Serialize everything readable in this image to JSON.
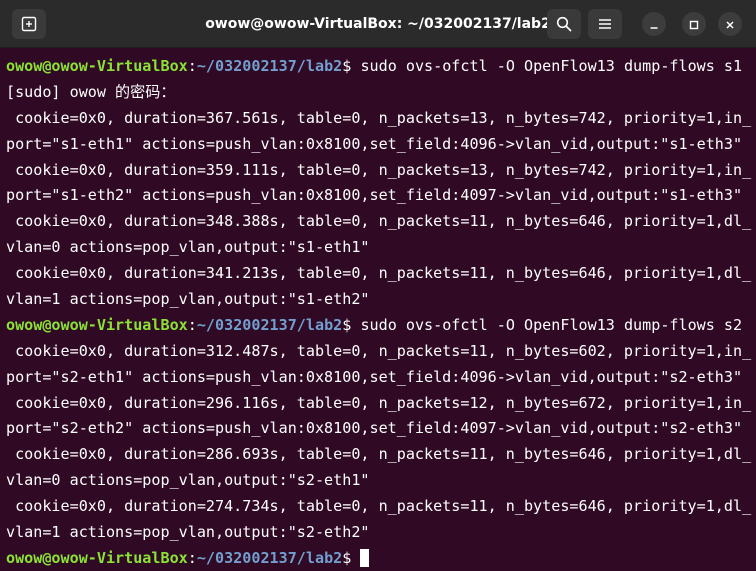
{
  "window": {
    "title": "owow@owow-VirtualBox: ~/032002137/lab2"
  },
  "icons": {
    "new_tab": "new-tab-icon",
    "search": "search-icon",
    "menu": "hamburger-menu-icon",
    "minimize": "minimize-icon",
    "maximize": "maximize-icon",
    "close": "close-icon"
  },
  "colors": {
    "terminal_bg": "#300a24",
    "prompt_user": "#8ae234",
    "prompt_path": "#729fcf",
    "text": "#ffffff"
  },
  "terminal": {
    "prompt": {
      "user_host": "owow@owow-VirtualBox",
      "colon": ":",
      "path": "~/032002137/lab2",
      "dollar": "$ "
    },
    "lines": [
      {
        "type": "cmd",
        "text": "sudo ovs-ofctl -O OpenFlow13 dump-flows s1"
      },
      {
        "type": "out",
        "text": "[sudo] owow 的密码："
      },
      {
        "type": "out",
        "text": " cookie=0x0, duration=367.561s, table=0, n_packets=13, n_bytes=742, priority=1,in_"
      },
      {
        "type": "out",
        "text": "port=\"s1-eth1\" actions=push_vlan:0x8100,set_field:4096->vlan_vid,output:\"s1-eth3\""
      },
      {
        "type": "out",
        "text": " cookie=0x0, duration=359.111s, table=0, n_packets=13, n_bytes=742, priority=1,in_"
      },
      {
        "type": "out",
        "text": "port=\"s1-eth2\" actions=push_vlan:0x8100,set_field:4097->vlan_vid,output:\"s1-eth3\""
      },
      {
        "type": "out",
        "text": " cookie=0x0, duration=348.388s, table=0, n_packets=11, n_bytes=646, priority=1,dl_"
      },
      {
        "type": "out",
        "text": "vlan=0 actions=pop_vlan,output:\"s1-eth1\""
      },
      {
        "type": "out",
        "text": " cookie=0x0, duration=341.213s, table=0, n_packets=11, n_bytes=646, priority=1,dl_"
      },
      {
        "type": "out",
        "text": "vlan=1 actions=pop_vlan,output:\"s1-eth2\""
      },
      {
        "type": "cmd",
        "text": "sudo ovs-ofctl -O OpenFlow13 dump-flows s2"
      },
      {
        "type": "out",
        "text": " cookie=0x0, duration=312.487s, table=0, n_packets=11, n_bytes=602, priority=1,in_"
      },
      {
        "type": "out",
        "text": "port=\"s2-eth1\" actions=push_vlan:0x8100,set_field:4096->vlan_vid,output:\"s2-eth3\""
      },
      {
        "type": "out",
        "text": " cookie=0x0, duration=296.116s, table=0, n_packets=12, n_bytes=672, priority=1,in_"
      },
      {
        "type": "out",
        "text": "port=\"s2-eth2\" actions=push_vlan:0x8100,set_field:4097->vlan_vid,output:\"s2-eth3\""
      },
      {
        "type": "out",
        "text": " cookie=0x0, duration=286.693s, table=0, n_packets=11, n_bytes=646, priority=1,dl_"
      },
      {
        "type": "out",
        "text": "vlan=0 actions=pop_vlan,output:\"s2-eth1\""
      },
      {
        "type": "out",
        "text": " cookie=0x0, duration=274.734s, table=0, n_packets=11, n_bytes=646, priority=1,dl_"
      },
      {
        "type": "out",
        "text": "vlan=1 actions=pop_vlan,output:\"s2-eth2\""
      },
      {
        "type": "cmd",
        "text": ""
      }
    ]
  }
}
